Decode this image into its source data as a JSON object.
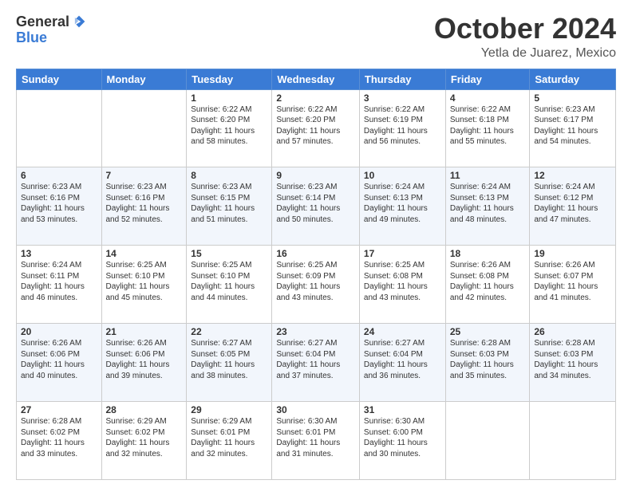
{
  "header": {
    "logo_general": "General",
    "logo_blue": "Blue",
    "month": "October 2024",
    "location": "Yetla de Juarez, Mexico"
  },
  "days_of_week": [
    "Sunday",
    "Monday",
    "Tuesday",
    "Wednesday",
    "Thursday",
    "Friday",
    "Saturday"
  ],
  "weeks": [
    [
      {
        "day": "",
        "sunrise": "",
        "sunset": "",
        "daylight": ""
      },
      {
        "day": "",
        "sunrise": "",
        "sunset": "",
        "daylight": ""
      },
      {
        "day": "1",
        "sunrise": "Sunrise: 6:22 AM",
        "sunset": "Sunset: 6:20 PM",
        "daylight": "Daylight: 11 hours and 58 minutes."
      },
      {
        "day": "2",
        "sunrise": "Sunrise: 6:22 AM",
        "sunset": "Sunset: 6:20 PM",
        "daylight": "Daylight: 11 hours and 57 minutes."
      },
      {
        "day": "3",
        "sunrise": "Sunrise: 6:22 AM",
        "sunset": "Sunset: 6:19 PM",
        "daylight": "Daylight: 11 hours and 56 minutes."
      },
      {
        "day": "4",
        "sunrise": "Sunrise: 6:22 AM",
        "sunset": "Sunset: 6:18 PM",
        "daylight": "Daylight: 11 hours and 55 minutes."
      },
      {
        "day": "5",
        "sunrise": "Sunrise: 6:23 AM",
        "sunset": "Sunset: 6:17 PM",
        "daylight": "Daylight: 11 hours and 54 minutes."
      }
    ],
    [
      {
        "day": "6",
        "sunrise": "Sunrise: 6:23 AM",
        "sunset": "Sunset: 6:16 PM",
        "daylight": "Daylight: 11 hours and 53 minutes."
      },
      {
        "day": "7",
        "sunrise": "Sunrise: 6:23 AM",
        "sunset": "Sunset: 6:16 PM",
        "daylight": "Daylight: 11 hours and 52 minutes."
      },
      {
        "day": "8",
        "sunrise": "Sunrise: 6:23 AM",
        "sunset": "Sunset: 6:15 PM",
        "daylight": "Daylight: 11 hours and 51 minutes."
      },
      {
        "day": "9",
        "sunrise": "Sunrise: 6:23 AM",
        "sunset": "Sunset: 6:14 PM",
        "daylight": "Daylight: 11 hours and 50 minutes."
      },
      {
        "day": "10",
        "sunrise": "Sunrise: 6:24 AM",
        "sunset": "Sunset: 6:13 PM",
        "daylight": "Daylight: 11 hours and 49 minutes."
      },
      {
        "day": "11",
        "sunrise": "Sunrise: 6:24 AM",
        "sunset": "Sunset: 6:13 PM",
        "daylight": "Daylight: 11 hours and 48 minutes."
      },
      {
        "day": "12",
        "sunrise": "Sunrise: 6:24 AM",
        "sunset": "Sunset: 6:12 PM",
        "daylight": "Daylight: 11 hours and 47 minutes."
      }
    ],
    [
      {
        "day": "13",
        "sunrise": "Sunrise: 6:24 AM",
        "sunset": "Sunset: 6:11 PM",
        "daylight": "Daylight: 11 hours and 46 minutes."
      },
      {
        "day": "14",
        "sunrise": "Sunrise: 6:25 AM",
        "sunset": "Sunset: 6:10 PM",
        "daylight": "Daylight: 11 hours and 45 minutes."
      },
      {
        "day": "15",
        "sunrise": "Sunrise: 6:25 AM",
        "sunset": "Sunset: 6:10 PM",
        "daylight": "Daylight: 11 hours and 44 minutes."
      },
      {
        "day": "16",
        "sunrise": "Sunrise: 6:25 AM",
        "sunset": "Sunset: 6:09 PM",
        "daylight": "Daylight: 11 hours and 43 minutes."
      },
      {
        "day": "17",
        "sunrise": "Sunrise: 6:25 AM",
        "sunset": "Sunset: 6:08 PM",
        "daylight": "Daylight: 11 hours and 43 minutes."
      },
      {
        "day": "18",
        "sunrise": "Sunrise: 6:26 AM",
        "sunset": "Sunset: 6:08 PM",
        "daylight": "Daylight: 11 hours and 42 minutes."
      },
      {
        "day": "19",
        "sunrise": "Sunrise: 6:26 AM",
        "sunset": "Sunset: 6:07 PM",
        "daylight": "Daylight: 11 hours and 41 minutes."
      }
    ],
    [
      {
        "day": "20",
        "sunrise": "Sunrise: 6:26 AM",
        "sunset": "Sunset: 6:06 PM",
        "daylight": "Daylight: 11 hours and 40 minutes."
      },
      {
        "day": "21",
        "sunrise": "Sunrise: 6:26 AM",
        "sunset": "Sunset: 6:06 PM",
        "daylight": "Daylight: 11 hours and 39 minutes."
      },
      {
        "day": "22",
        "sunrise": "Sunrise: 6:27 AM",
        "sunset": "Sunset: 6:05 PM",
        "daylight": "Daylight: 11 hours and 38 minutes."
      },
      {
        "day": "23",
        "sunrise": "Sunrise: 6:27 AM",
        "sunset": "Sunset: 6:04 PM",
        "daylight": "Daylight: 11 hours and 37 minutes."
      },
      {
        "day": "24",
        "sunrise": "Sunrise: 6:27 AM",
        "sunset": "Sunset: 6:04 PM",
        "daylight": "Daylight: 11 hours and 36 minutes."
      },
      {
        "day": "25",
        "sunrise": "Sunrise: 6:28 AM",
        "sunset": "Sunset: 6:03 PM",
        "daylight": "Daylight: 11 hours and 35 minutes."
      },
      {
        "day": "26",
        "sunrise": "Sunrise: 6:28 AM",
        "sunset": "Sunset: 6:03 PM",
        "daylight": "Daylight: 11 hours and 34 minutes."
      }
    ],
    [
      {
        "day": "27",
        "sunrise": "Sunrise: 6:28 AM",
        "sunset": "Sunset: 6:02 PM",
        "daylight": "Daylight: 11 hours and 33 minutes."
      },
      {
        "day": "28",
        "sunrise": "Sunrise: 6:29 AM",
        "sunset": "Sunset: 6:02 PM",
        "daylight": "Daylight: 11 hours and 32 minutes."
      },
      {
        "day": "29",
        "sunrise": "Sunrise: 6:29 AM",
        "sunset": "Sunset: 6:01 PM",
        "daylight": "Daylight: 11 hours and 32 minutes."
      },
      {
        "day": "30",
        "sunrise": "Sunrise: 6:30 AM",
        "sunset": "Sunset: 6:01 PM",
        "daylight": "Daylight: 11 hours and 31 minutes."
      },
      {
        "day": "31",
        "sunrise": "Sunrise: 6:30 AM",
        "sunset": "Sunset: 6:00 PM",
        "daylight": "Daylight: 11 hours and 30 minutes."
      },
      {
        "day": "",
        "sunrise": "",
        "sunset": "",
        "daylight": ""
      },
      {
        "day": "",
        "sunrise": "",
        "sunset": "",
        "daylight": ""
      }
    ]
  ]
}
